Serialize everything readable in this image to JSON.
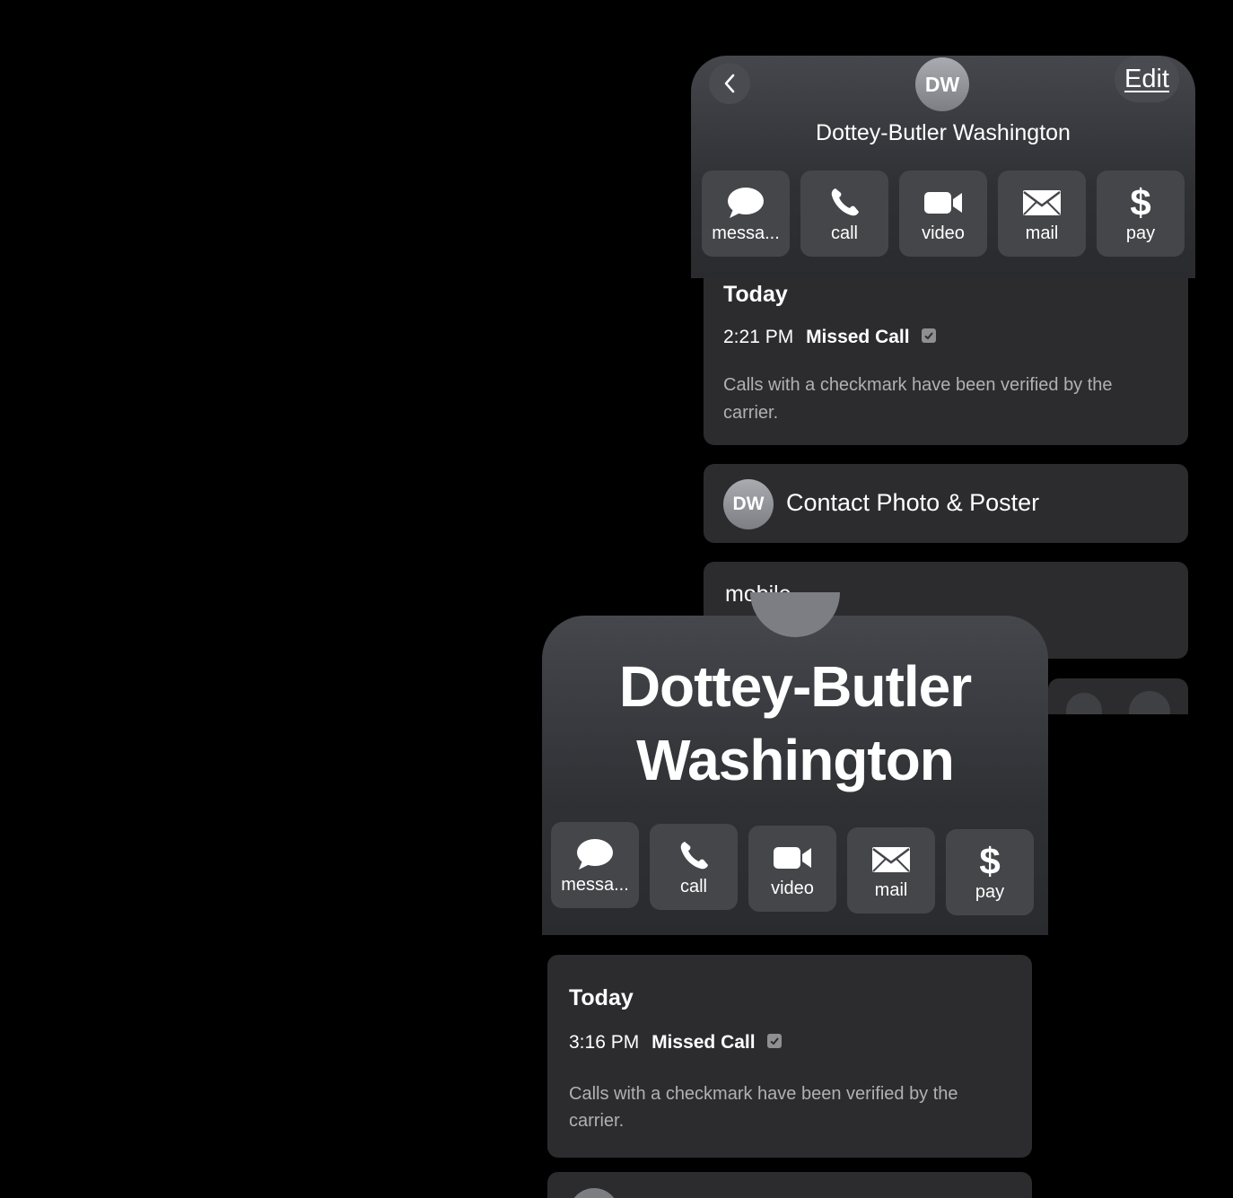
{
  "top_screen": {
    "back_icon": "chevron-left-icon",
    "avatar_initials": "DW",
    "edit_label": "Edit",
    "contact_name": "Dottey-Butler Washington",
    "actions": [
      {
        "label": "messa...",
        "icon": "message-bubble-icon"
      },
      {
        "label": "call",
        "icon": "phone-icon"
      },
      {
        "label": "video",
        "icon": "video-camera-icon"
      },
      {
        "label": "mail",
        "icon": "envelope-icon"
      },
      {
        "label": "pay",
        "icon": "dollar-icon"
      }
    ],
    "recents": {
      "heading": "Today",
      "time": "2:21 PM",
      "status": "Missed Call",
      "note": "Calls with a checkmark have been verified by the carrier."
    },
    "contact_photo_label": "Contact Photo & Poster",
    "contact_photo_initials": "DW",
    "phone_label": "mobile"
  },
  "bottom_screen": {
    "contact_name_line1": "Dottey-Butler",
    "contact_name_line2": "Washington",
    "actions": [
      {
        "label": "messa...",
        "icon": "message-bubble-icon"
      },
      {
        "label": "call",
        "icon": "phone-icon"
      },
      {
        "label": "video",
        "icon": "video-camera-icon"
      },
      {
        "label": "mail",
        "icon": "envelope-icon"
      },
      {
        "label": "pay",
        "icon": "dollar-icon"
      }
    ],
    "recents": {
      "heading": "Today",
      "time": "3:16 PM",
      "status": "Missed Call",
      "note": "Calls with a checkmark have been verified by the carrier."
    }
  },
  "colors": {
    "background": "#000000",
    "card": "#2c2c2e",
    "button": "#45464a",
    "secondary_text": "#b0b0b5"
  }
}
